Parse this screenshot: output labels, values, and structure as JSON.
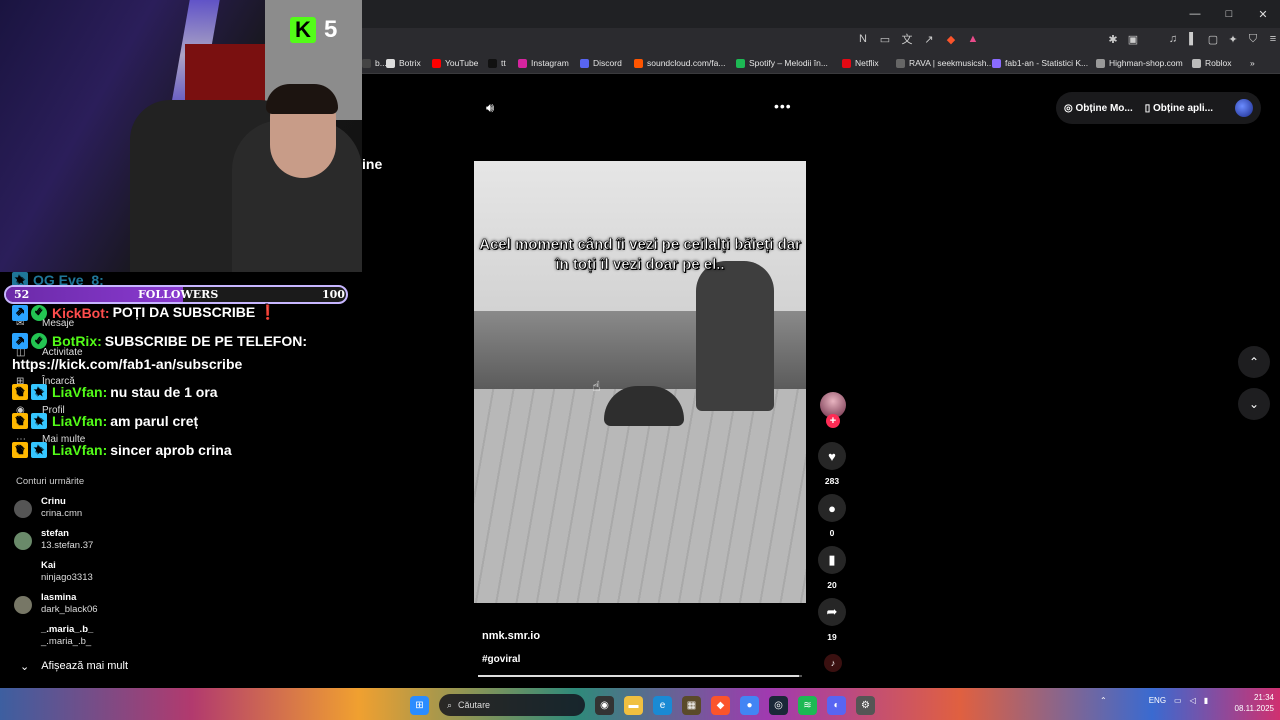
{
  "window_controls": [
    "—",
    "□",
    "✕"
  ],
  "bookmarks": [
    {
      "label": "b...",
      "color": "#444"
    },
    {
      "label": "Botrix",
      "color": "#ddd"
    },
    {
      "label": "YouTube",
      "color": "#ff0000"
    },
    {
      "label": "tt",
      "color": "#111"
    },
    {
      "label": "Instagram",
      "color": "#d6249f"
    },
    {
      "label": "Discord",
      "color": "#5865f2"
    },
    {
      "label": "soundcloud.com/fa...",
      "color": "#ff5500"
    },
    {
      "label": "Spotify – Melodii în...",
      "color": "#1db954"
    },
    {
      "label": "Netflix",
      "color": "#e50914"
    },
    {
      "label": "RAVA | seekmusicsh...",
      "color": "#666"
    },
    {
      "label": "fab1-an - Statistici K...",
      "color": "#8a6bff"
    },
    {
      "label": "Highman-shop.com",
      "color": "#999"
    },
    {
      "label": "Roblox",
      "color": "#bbb"
    }
  ],
  "header": {
    "get_coins": "Obține Mo...",
    "get_app": "Obține apli..."
  },
  "video": {
    "caption": "Acel moment când îi vezi pe ceilalți băieți dar în toți îl vezi doar pe el..",
    "author": "nmk.smr.io",
    "hashtag": "#goviral",
    "progress": 0.99
  },
  "actions": {
    "likes": "283",
    "comments": "0",
    "saves": "20",
    "shares": "19"
  },
  "stream": {
    "viewer_count": "5",
    "followers_label": "FOLLOWERS",
    "followers_current": "52",
    "followers_goal": "100",
    "followers_progress": 0.52,
    "partial_text": "ine"
  },
  "chat": [
    {
      "user": "KickBot:",
      "msg": "POȚI DA SUBSCRIBE ❗",
      "color": "#ff4d4d",
      "badges": [
        "b-bot",
        "b-check"
      ]
    },
    {
      "user": "BotRix:",
      "msg": "SUBSCRIBE DE PE TELEFON:",
      "color": "#53fc18",
      "badges": [
        "b-bot",
        "b-check"
      ]
    },
    {
      "user": "LiaVfan:",
      "msg": "nu stau de 1 ora",
      "color": "#53fc18",
      "badges": [
        "b-crown",
        "b-sub"
      ]
    },
    {
      "user": "LiaVfan:",
      "msg": "am parul creț",
      "color": "#53fc18",
      "badges": [
        "b-crown",
        "b-sub"
      ]
    },
    {
      "user": "LiaVfan:",
      "msg": "sincer aprob crina",
      "color": "#53fc18",
      "badges": [
        "b-crown",
        "b-sub"
      ]
    }
  ],
  "chat_link": "https://kick.com/fab1-an/subscribe",
  "chat_partial_top": "OG Eve_8:",
  "sidebar": {
    "messages": "Mesaje",
    "activity": "Activitate",
    "upload": "Încarcă",
    "profile": "Profil",
    "more": "Mai multe",
    "following_title": "Conturi urmărite",
    "following": [
      {
        "name": "Crinu",
        "handle": "crina.cmn"
      },
      {
        "name": "stefan",
        "handle": "13.stefan.37"
      },
      {
        "name": "Kai",
        "handle": "ninjago3313"
      },
      {
        "name": "Iasmina",
        "handle": "dark_black06"
      },
      {
        "name": "_.maria_.b_",
        "handle": "_.maria_.b_"
      }
    ],
    "show_more": "Afișează mai mult"
  },
  "taskbar": {
    "search_placeholder": "Căutare",
    "lang": "ENG",
    "time": "21:34",
    "date": "08.11.2025"
  }
}
